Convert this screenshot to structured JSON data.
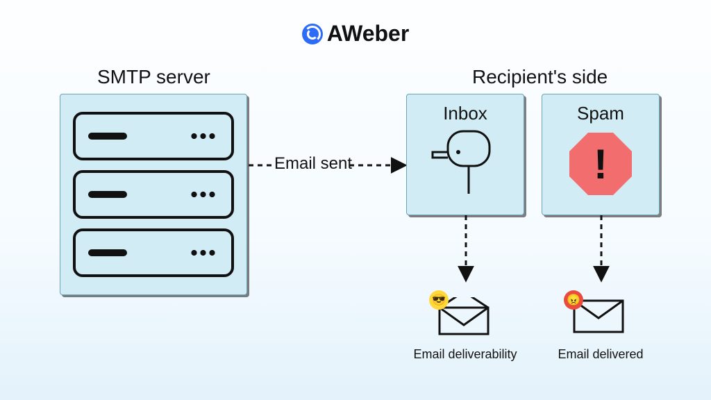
{
  "logo": {
    "text": "AWeber"
  },
  "smtp_server": {
    "title": "SMTP server"
  },
  "recipient_side": {
    "title": "Recipient's side"
  },
  "flow": {
    "email_sent_label": "Email sent"
  },
  "inbox": {
    "title": "Inbox",
    "caption": "Email deliverability"
  },
  "spam": {
    "title": "Spam",
    "caption": "Email delivered"
  }
}
